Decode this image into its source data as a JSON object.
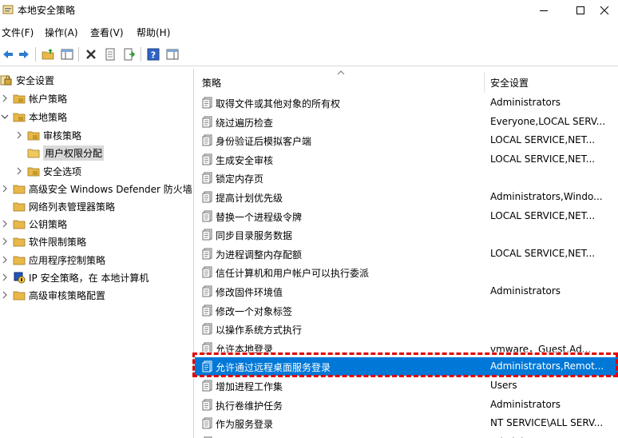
{
  "window": {
    "title": "本地安全策略"
  },
  "menu": [
    "文件(F)",
    "操作(A)",
    "查看(V)",
    "帮助(H)"
  ],
  "tree": {
    "root": "安全设置",
    "items": [
      {
        "label": "帐户策略",
        "level": 1,
        "expanded": false
      },
      {
        "label": "本地策略",
        "level": 1,
        "expanded": true
      },
      {
        "label": "审核策略",
        "level": 2,
        "expanded": false
      },
      {
        "label": "用户权限分配",
        "level": 2,
        "expanded": false,
        "selected": true
      },
      {
        "label": "安全选项",
        "level": 2,
        "expanded": false
      },
      {
        "label": "高级安全 Windows Defender 防火墙",
        "level": 1,
        "expanded": false
      },
      {
        "label": "网络列表管理器策略",
        "level": 1,
        "expanded": false
      },
      {
        "label": "公钥策略",
        "level": 1,
        "expanded": false
      },
      {
        "label": "软件限制策略",
        "level": 1,
        "expanded": false
      },
      {
        "label": "应用程序控制策略",
        "level": 1,
        "expanded": false
      },
      {
        "label": "IP 安全策略，在 本地计算机",
        "level": 1,
        "expanded": false
      },
      {
        "label": "高级审核策略配置",
        "level": 1,
        "expanded": false
      }
    ]
  },
  "columns": {
    "policy": "策略",
    "setting": "安全设置"
  },
  "policies": [
    {
      "name": "取得文件或其他对象的所有权",
      "value": "Administrators"
    },
    {
      "name": "绕过遍历检查",
      "value": "Everyone,LOCAL SERV..."
    },
    {
      "name": "身份验证后模拟客户端",
      "value": "LOCAL SERVICE,NET..."
    },
    {
      "name": "生成安全审核",
      "value": "LOCAL SERVICE,NET..."
    },
    {
      "name": "锁定内存页",
      "value": ""
    },
    {
      "name": "提高计划优先级",
      "value": "Administrators,Windo..."
    },
    {
      "name": "替换一个进程级令牌",
      "value": "LOCAL SERVICE,NET..."
    },
    {
      "name": "同步目录服务数据",
      "value": ""
    },
    {
      "name": "为进程调整内存配额",
      "value": "LOCAL SERVICE,NET..."
    },
    {
      "name": "信任计算机和用户帐户可以执行委派",
      "value": ""
    },
    {
      "name": "修改固件环境值",
      "value": "Administrators"
    },
    {
      "name": "修改一个对象标签",
      "value": ""
    },
    {
      "name": "以操作系统方式执行",
      "value": ""
    },
    {
      "name": "允许本地登录",
      "value": "vmware，Guest,Ad..."
    },
    {
      "name": "允许通过远程桌面服务登录",
      "value": "Administrators,Remot...",
      "selected": true
    },
    {
      "name": "增加进程工作集",
      "value": "Users"
    },
    {
      "name": "执行卷维护任务",
      "value": "Administrators"
    },
    {
      "name": "作为服务登录",
      "value": "NT SERVICE\\ALL SERV..."
    },
    {
      "name": "作为批处理作业登录",
      "value": "Administrators"
    }
  ],
  "colors": {
    "selection": "#0078d7",
    "highlight": "#e00000",
    "folder": "#e8b84a"
  }
}
